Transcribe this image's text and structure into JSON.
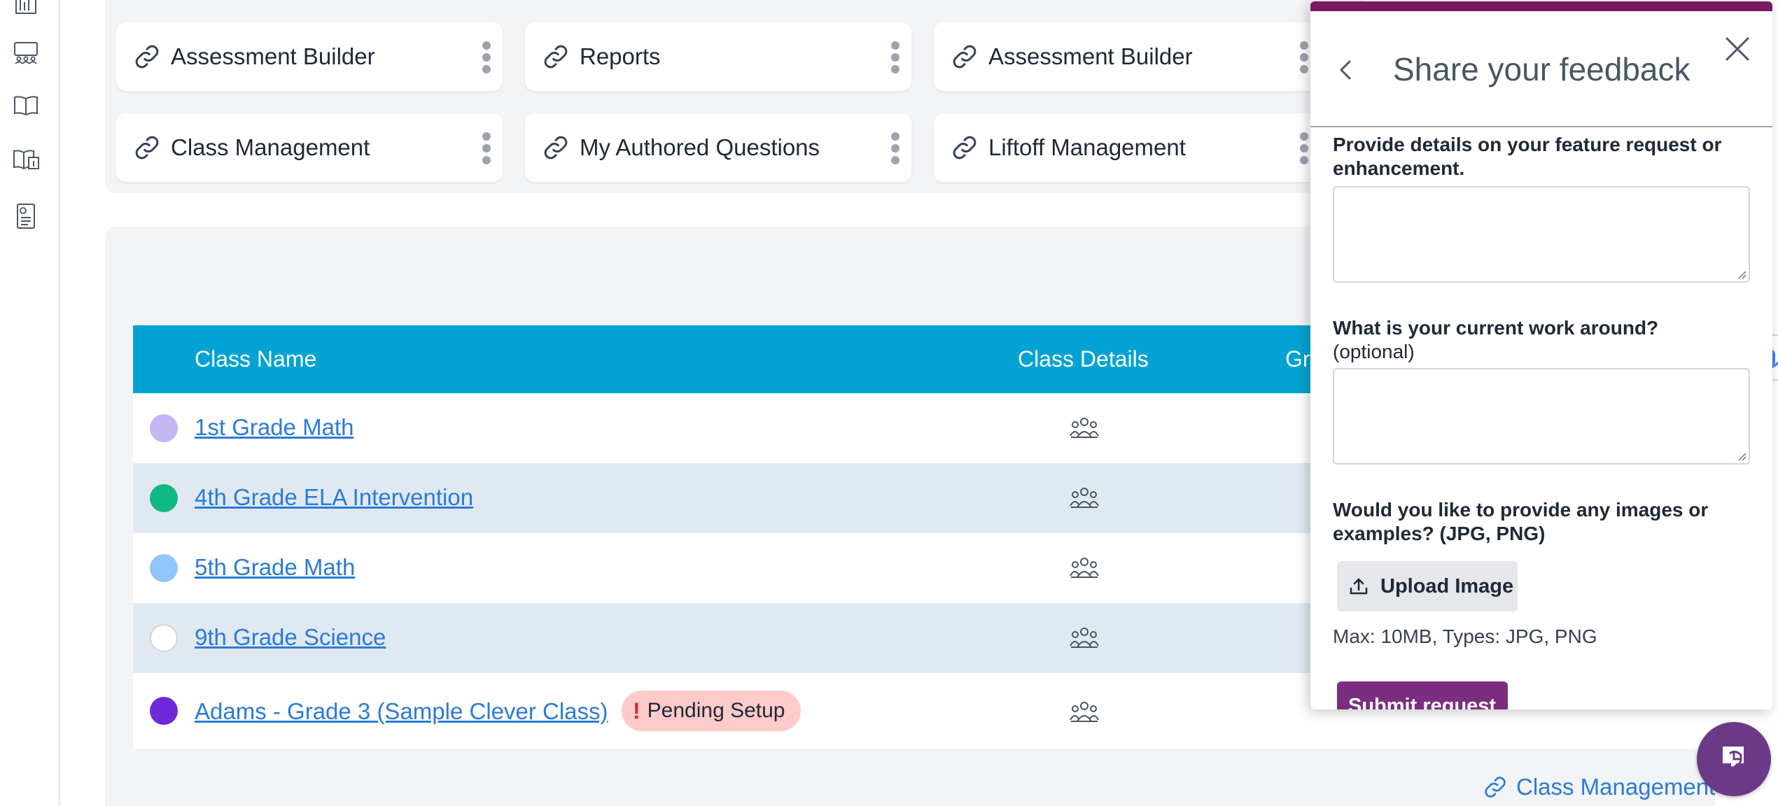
{
  "sidebar": {
    "icons": [
      "bar-chart-icon",
      "classroom-icon",
      "book-icon",
      "book-info-icon",
      "report-doc-icon"
    ]
  },
  "quick_links": [
    {
      "label": "Assessment Builder"
    },
    {
      "label": "Reports"
    },
    {
      "label": "Assessment Builder"
    },
    {
      "label": "Class Management"
    },
    {
      "label": "My Authored Questions"
    },
    {
      "label": "Liftoff Management"
    }
  ],
  "table": {
    "headers": {
      "class_name": "Class Name",
      "class_details": "Class Details",
      "partial": "Gr"
    },
    "rows": [
      {
        "name": "1st Grade Math",
        "dot_color": "#c4b5f4"
      },
      {
        "name": "4th Grade ELA Intervention",
        "dot_color": "#10b981"
      },
      {
        "name": "5th Grade Math",
        "dot_color": "#93c5fd"
      },
      {
        "name": "9th Grade Science",
        "dot_color": "#ffffff"
      },
      {
        "name": "Adams - Grade 3 (Sample Clever Class)",
        "dot_color": "#6d28d9",
        "badge": "Pending Setup",
        "badge_icon": "!"
      }
    ]
  },
  "bottom_link": {
    "label": "Class Management"
  },
  "feedback": {
    "title": "Share your feedback",
    "q1": "Provide details on your feature request or enhancement.",
    "q1_line1": "Provide details on your feature request or",
    "q1_line2": "enhancement.",
    "q2": "What is your current work around?",
    "q2_optional": "(optional)",
    "q3_line1": "Would you like to provide any images or",
    "q3_line2": "examples? (JPG, PNG)",
    "upload_label": "Upload Image",
    "hint": "Max: 10MB, Types: JPG, PNG",
    "submit_label": "Submit request"
  },
  "colors": {
    "accent": "#00a3d3",
    "link": "#2b7bd6",
    "brand": "#7b1a63",
    "row_alt": "#e0e9f2",
    "badge_bg": "#fecaca"
  }
}
